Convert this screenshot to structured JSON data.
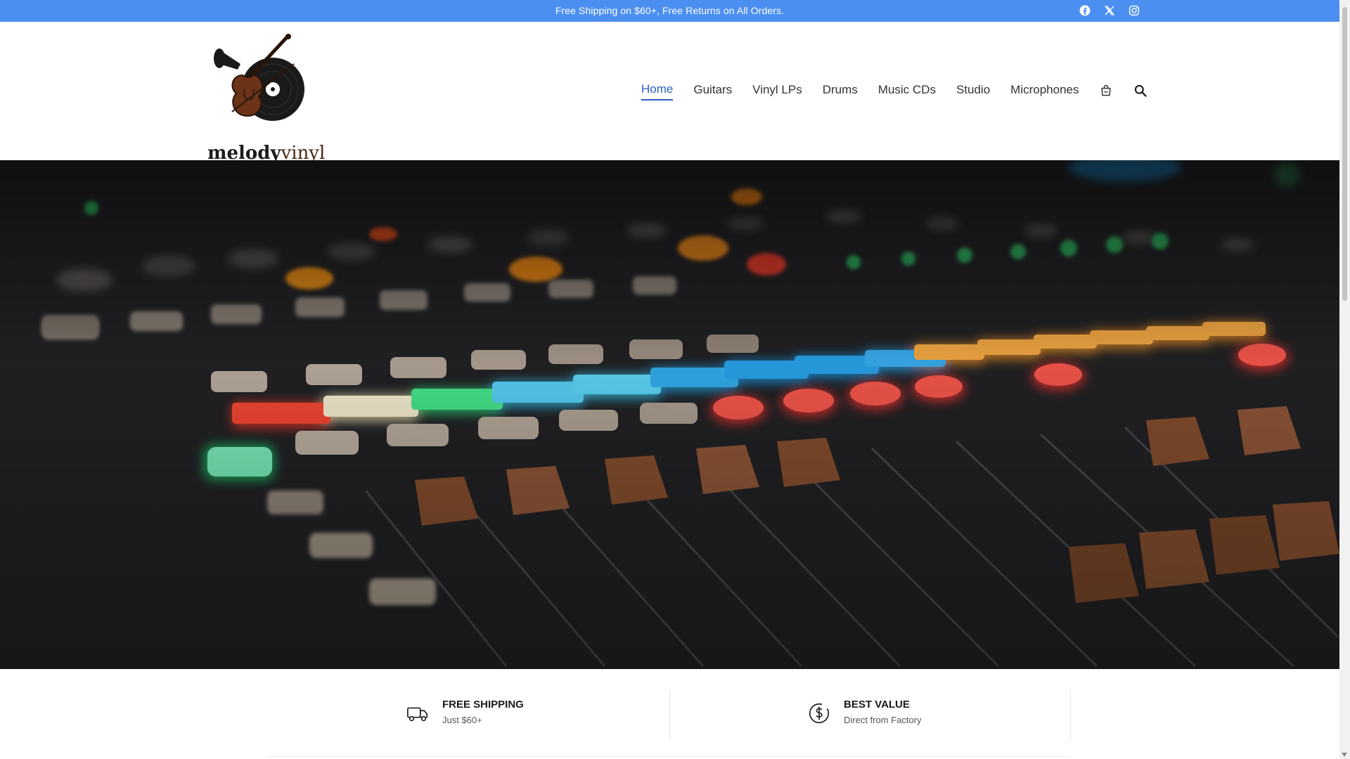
{
  "topbar": {
    "message": "Free Shipping on $60+, Free Returns on All Orders.",
    "social": [
      "facebook-icon",
      "x-icon",
      "instagram-icon"
    ],
    "background": "#4b8ff0"
  },
  "brand": {
    "name_part1": "melody",
    "name_part2": "vinyl"
  },
  "nav": {
    "items": [
      {
        "label": "Home",
        "active": true
      },
      {
        "label": "Guitars"
      },
      {
        "label": "Vinyl LPs"
      },
      {
        "label": "Drums"
      },
      {
        "label": "Music CDs"
      },
      {
        "label": "Studio"
      },
      {
        "label": "Microphones"
      }
    ],
    "icons": [
      "cart-icon",
      "search-icon"
    ],
    "active_color": "#2b5fbf"
  },
  "hero": {
    "image": "audio-mixing-console-photo"
  },
  "features": [
    {
      "title": "FREE SHIPPING",
      "subtitle": "Just $60+",
      "icon": "truck-icon"
    },
    {
      "title": "BEST VALUE",
      "subtitle": "Direct from Factory",
      "icon": "dollar-circle-icon"
    }
  ]
}
